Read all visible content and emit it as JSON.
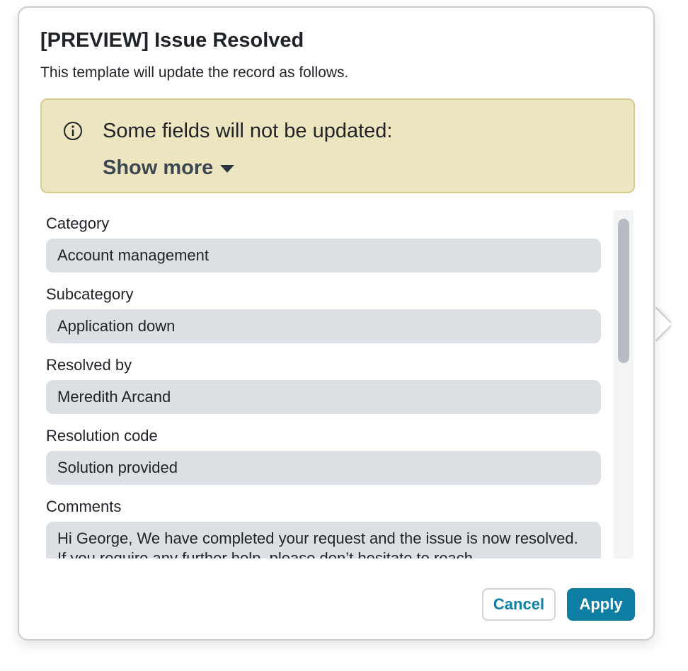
{
  "dialog": {
    "title": "[PREVIEW] Issue Resolved",
    "subtitle": "This template will update the record as follows."
  },
  "notice": {
    "icon": "info-icon",
    "message": "Some fields will not be updated:",
    "toggle_label": "Show more"
  },
  "fields": [
    {
      "label": "Category",
      "value": "Account management"
    },
    {
      "label": "Subcategory",
      "value": "Application down"
    },
    {
      "label": "Resolved by",
      "value": "Meredith Arcand"
    },
    {
      "label": "Resolution code",
      "value": "Solution provided"
    },
    {
      "label": "Comments",
      "value": "Hi George, We have completed your request and the issue is now resolved. If you require any further help, please don’t hesitate to reach"
    }
  ],
  "buttons": {
    "cancel": "Cancel",
    "apply": "Apply"
  },
  "colors": {
    "accent": "#0e7fa3",
    "notice_bg": "#ede5c0",
    "field_bg": "#dcdfe3"
  }
}
